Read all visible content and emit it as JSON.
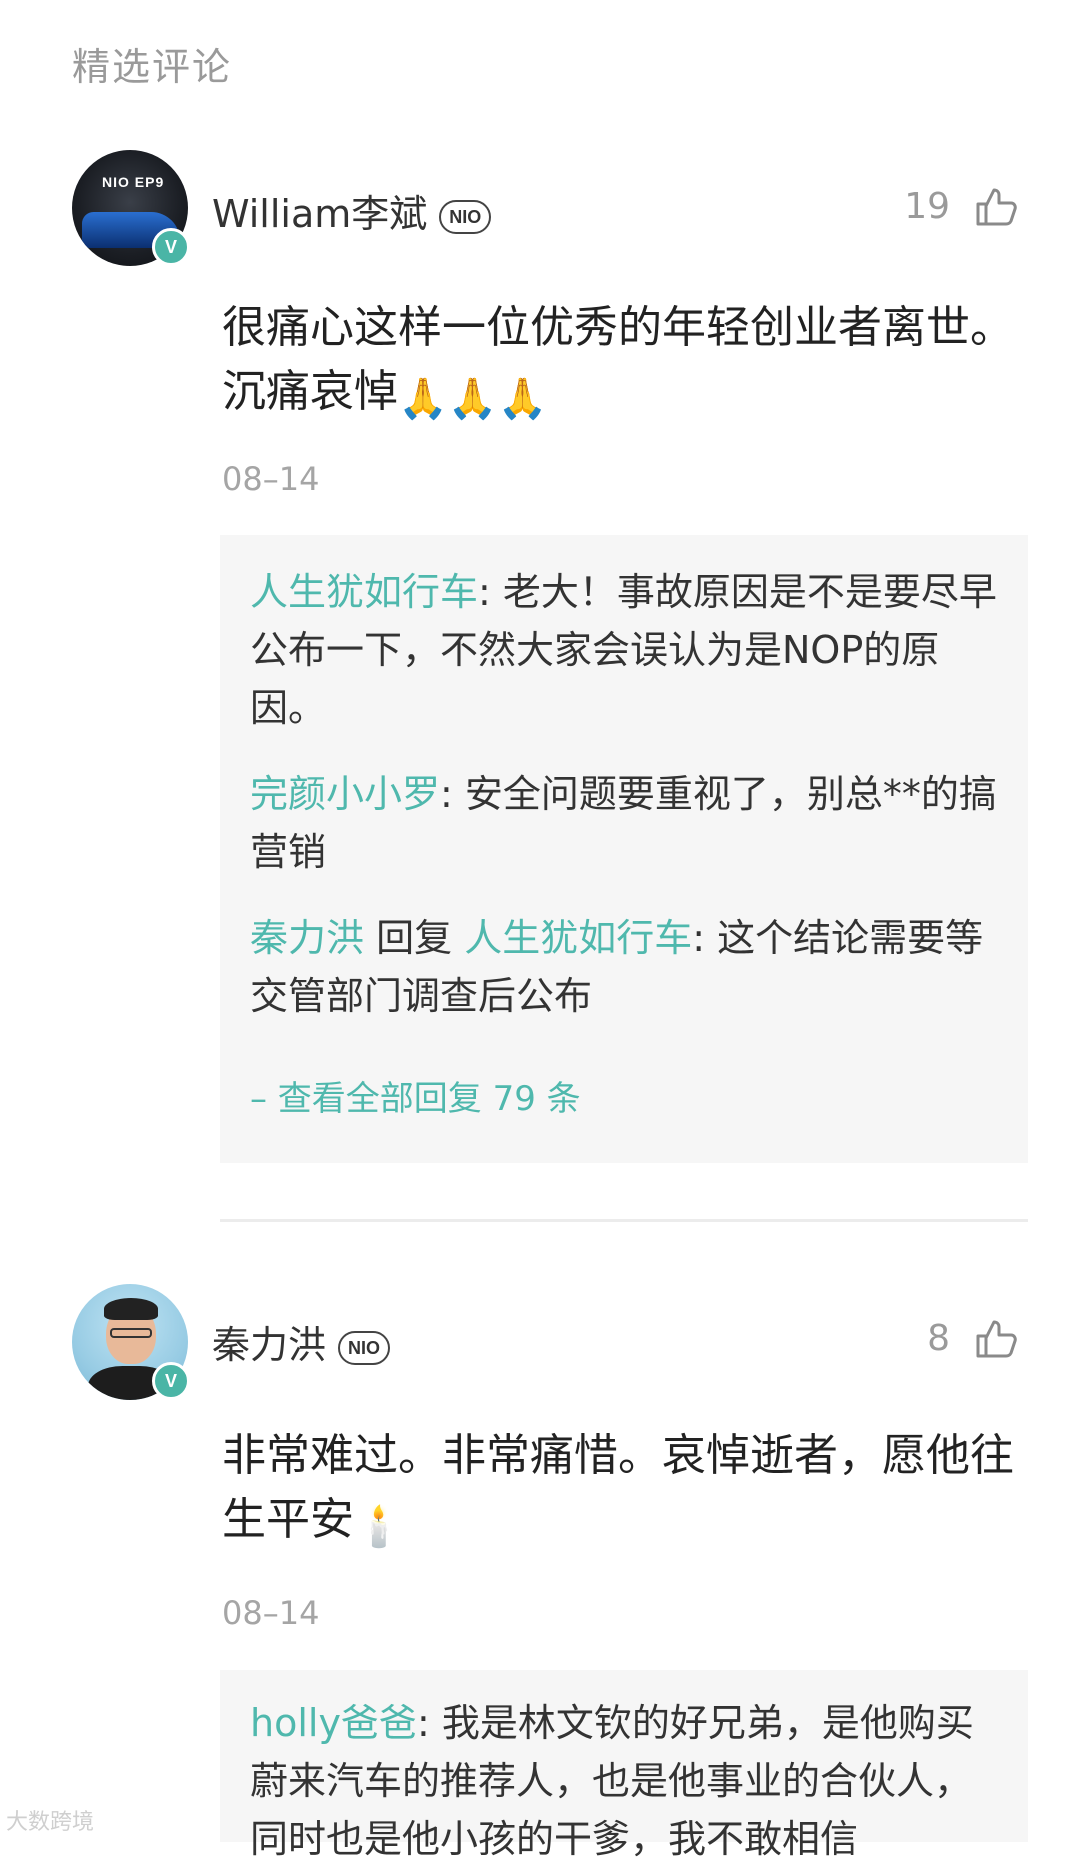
{
  "section_title": "精选评论",
  "comments": [
    {
      "username": "William李斌",
      "badge": "NIO",
      "likes": "19",
      "content": "很痛心这样一位优秀的年轻创业者离世。沉痛哀悼",
      "emoji": "🙏🙏🙏",
      "date": "08–14",
      "avatar_brand": "NIO EP9",
      "replies": [
        {
          "name": "人生犹如行车",
          "sep": ": ",
          "text": "老大！事故原因是不是要尽早公布一下，不然大家会误认为是NOP的原因。"
        },
        {
          "name": "完颜小小罗",
          "sep": ": ",
          "text": "安全问题要重视了，别总**的搞营销"
        },
        {
          "name": "秦力洪",
          "middle": " 回复 ",
          "name2": "人生犹如行车",
          "sep": ": ",
          "text": "这个结论需要等交管部门调查后公布"
        }
      ],
      "view_all": "– 查看全部回复 79 条"
    },
    {
      "username": "秦力洪",
      "badge": "NIO",
      "likes": "8",
      "content": "非常难过。非常痛惜。哀悼逝者，愿他往生平安",
      "emoji": "🕯️",
      "date": "08–14",
      "replies": [
        {
          "name": "holly爸爸",
          "sep": ": ",
          "text": "我是林文钦的好兄弟，是他购买蔚来汽车的推荐人，也是他事业的合伙人，同时也是他小孩的干爹，我不敢相信"
        }
      ]
    }
  ],
  "verified_mark": "V",
  "watermark": "大数跨境",
  "colors": {
    "accent": "#4fb8ad",
    "verified": "#4ab5a6",
    "muted": "#9a9a9a"
  }
}
